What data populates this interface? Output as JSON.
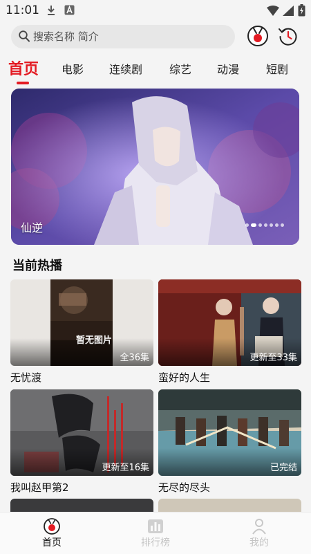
{
  "status_bar": {
    "time": "11:01"
  },
  "search": {
    "placeholder": "搜索名称 简介"
  },
  "tabs": [
    {
      "label": "首页",
      "active": true
    },
    {
      "label": "电影"
    },
    {
      "label": "连续剧"
    },
    {
      "label": "综艺"
    },
    {
      "label": "动漫"
    },
    {
      "label": "短剧"
    }
  ],
  "banner": {
    "caption": "仙逆",
    "dot_count": 7,
    "active_dot": 1
  },
  "section": {
    "title": "当前热播"
  },
  "cards": [
    {
      "title": "无忧渡",
      "badge": "全36集",
      "placeholder_text": "暂无图片"
    },
    {
      "title": "蛮好的人生",
      "badge": "更新至33集"
    },
    {
      "title": "我叫赵甲第2",
      "badge": "更新至16集"
    },
    {
      "title": "无尽的尽头",
      "badge": "已完结"
    }
  ],
  "bottom_nav": [
    {
      "label": "首页",
      "icon": "home-icon",
      "active": true
    },
    {
      "label": "排行榜",
      "icon": "ranking-icon"
    },
    {
      "label": "我的",
      "icon": "profile-icon"
    }
  ],
  "colors": {
    "accent": "#e31b23",
    "inactive": "#c4c4c4"
  }
}
